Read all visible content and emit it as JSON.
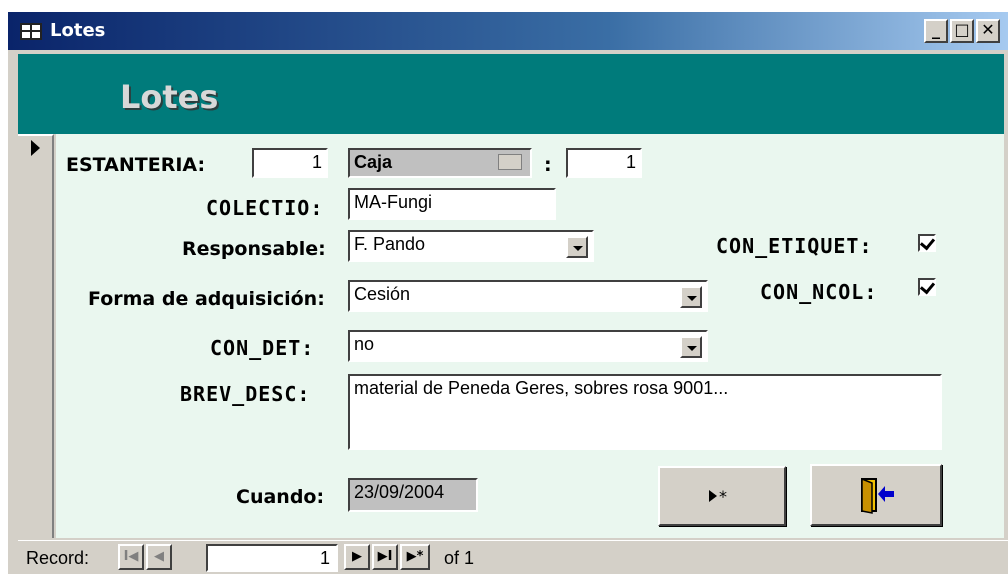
{
  "window": {
    "title": "Lotes"
  },
  "form": {
    "header_title": "Lotes",
    "estanteria": {
      "label": "ESTANTERIA:",
      "value": "1"
    },
    "caja": {
      "label": "Caja",
      "separator": ":",
      "value": "1"
    },
    "colectio": {
      "label": "COLECTIO:",
      "value": "MA-Fungi"
    },
    "responsable": {
      "label": "Responsable:",
      "value": "F. Pando"
    },
    "forma": {
      "label": "Forma de adquisición:",
      "value": "Cesión"
    },
    "con_det": {
      "label": "CON_DET:",
      "value": "no"
    },
    "con_etiquet": {
      "label": "CON_ETIQUET:",
      "checked": true
    },
    "con_ncol": {
      "label": "CON_NCOL:",
      "checked": true
    },
    "brev_desc": {
      "label": "BREV_DESC:",
      "value": "material de Peneda Geres, sobres rosa 9001..."
    },
    "cuando": {
      "label": "Cuando:",
      "value": "23/09/2004"
    }
  },
  "navigation": {
    "record_label": "Record:",
    "current": "1",
    "of_label": "of 1",
    "first": "I◀",
    "prev": "◀",
    "next": "▶",
    "last": "▶I",
    "new": "▶*"
  },
  "buttons": {
    "new_record_icon": "new-record-icon",
    "exit_icon": "exit-door-icon"
  }
}
